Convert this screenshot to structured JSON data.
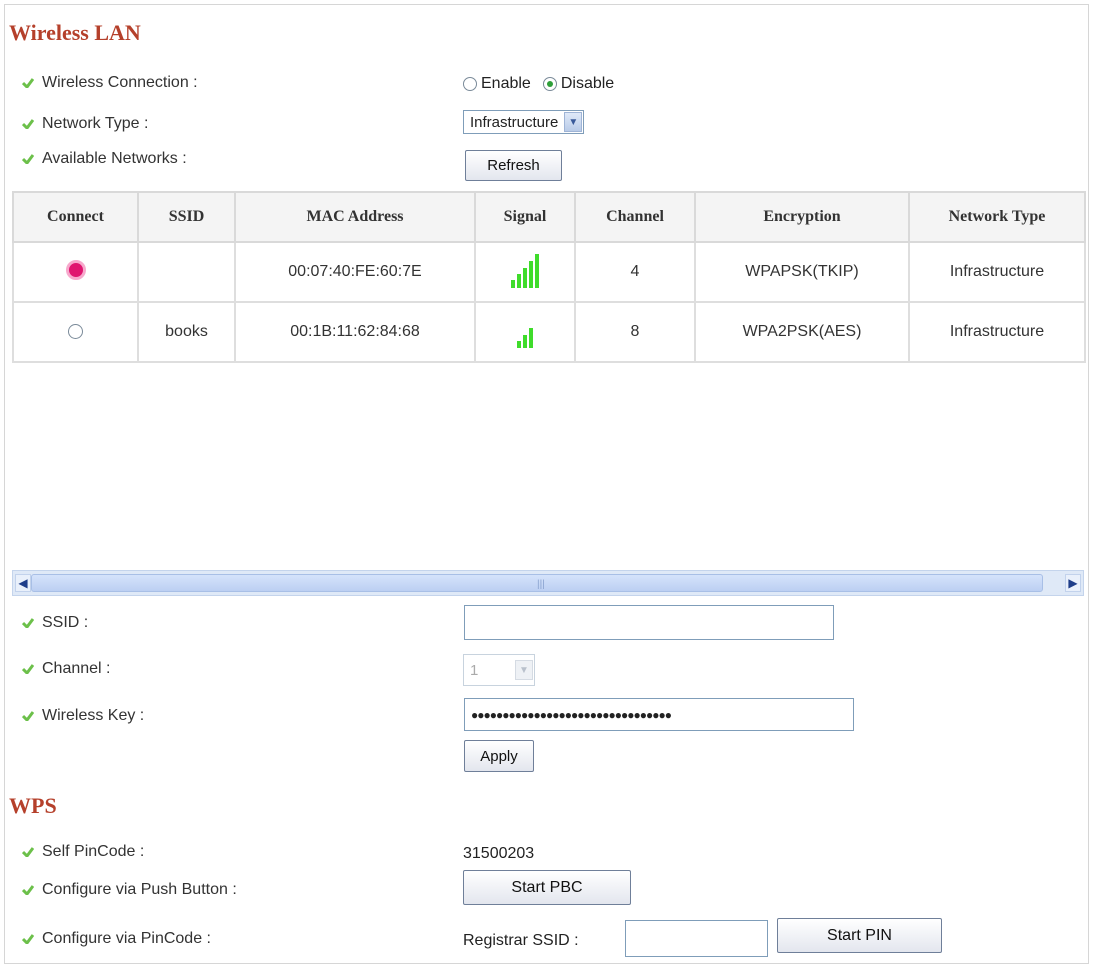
{
  "wireless_lan": {
    "title": "Wireless LAN",
    "connection_label": "Wireless Connection :",
    "enable_label": "Enable",
    "disable_label": "Disable",
    "connection_value": "Disable",
    "network_type_label": "Network Type :",
    "network_type_value": "Infrastructure",
    "available_networks_label": "Available Networks :",
    "refresh_label": "Refresh"
  },
  "networks_table": {
    "headers": [
      "Connect",
      "SSID",
      "MAC Address",
      "Signal",
      "Channel",
      "Encryption",
      "Network Type"
    ],
    "rows": [
      {
        "selected": true,
        "ssid": "",
        "mac": "00:07:40:FE:60:7E",
        "signal_bars": 5,
        "channel": "4",
        "encryption": "WPAPSK(TKIP)",
        "network_type": "Infrastructure"
      },
      {
        "selected": false,
        "ssid": "books",
        "mac": "00:1B:11:62:84:68",
        "signal_bars": 3,
        "channel": "8",
        "encryption": "WPA2PSK(AES)",
        "network_type": "Infrastructure"
      }
    ]
  },
  "connect_form": {
    "ssid_label": "SSID :",
    "ssid_value": "",
    "channel_label": "Channel :",
    "channel_value": "1",
    "key_label": "Wireless Key :",
    "key_value": "●●●●●●●●●●●●●●●●●●●●●●●●●●●●●●●●",
    "apply_label": "Apply"
  },
  "wps": {
    "title": "WPS",
    "pincode_label": "Self PinCode :",
    "pincode_value": "31500203",
    "pbc_label": "Configure via Push Button :",
    "pbc_button": "Start PBC",
    "pin_label": "Configure via PinCode :",
    "registrar_label": "Registrar SSID :",
    "registrar_value": "",
    "pin_button": "Start PIN"
  },
  "colors": {
    "section_title": "#b5402b",
    "bullet": "#6cc04a",
    "signal": "#3fdc2b",
    "selected_radio": "#e0156f"
  }
}
